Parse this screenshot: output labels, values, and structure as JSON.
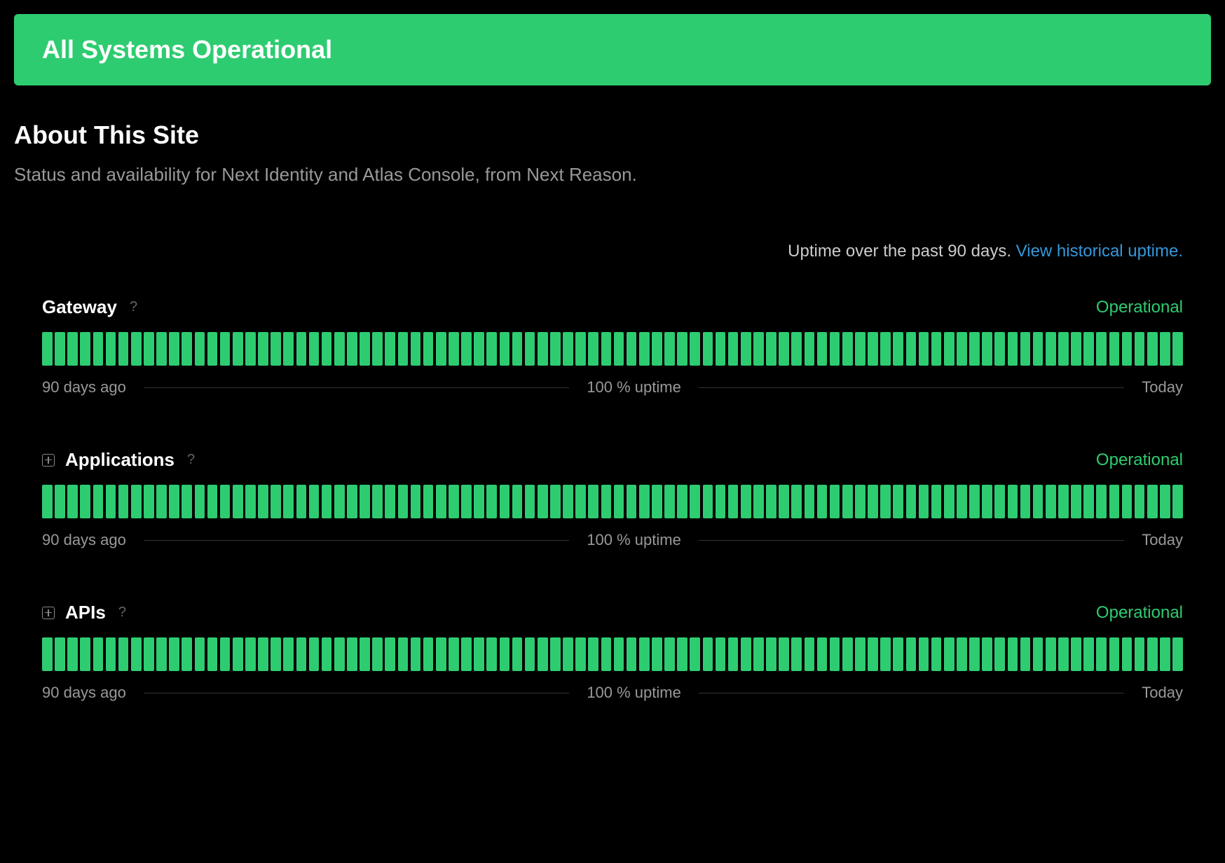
{
  "banner": {
    "text": "All Systems Operational",
    "color": "#2ecc71"
  },
  "about": {
    "title": "About This Site",
    "description": "Status and availability for Next Identity and Atlas Console, from Next Reason."
  },
  "uptime_header": {
    "prefix": "Uptime over the past 90 days. ",
    "link_text": "View historical uptime."
  },
  "components": [
    {
      "name": "Gateway",
      "status": "Operational",
      "expandable": false,
      "has_help": true,
      "uptime_pct": "100 % uptime",
      "left_label": "90 days ago",
      "right_label": "Today",
      "days": 90
    },
    {
      "name": "Applications",
      "status": "Operational",
      "expandable": true,
      "has_help": true,
      "uptime_pct": "100 % uptime",
      "left_label": "90 days ago",
      "right_label": "Today",
      "days": 90
    },
    {
      "name": "APIs",
      "status": "Operational",
      "expandable": true,
      "has_help": true,
      "uptime_pct": "100 % uptime",
      "left_label": "90 days ago",
      "right_label": "Today",
      "days": 90
    }
  ],
  "colors": {
    "operational": "#2ecc71",
    "link": "#3498db",
    "muted": "#999"
  }
}
